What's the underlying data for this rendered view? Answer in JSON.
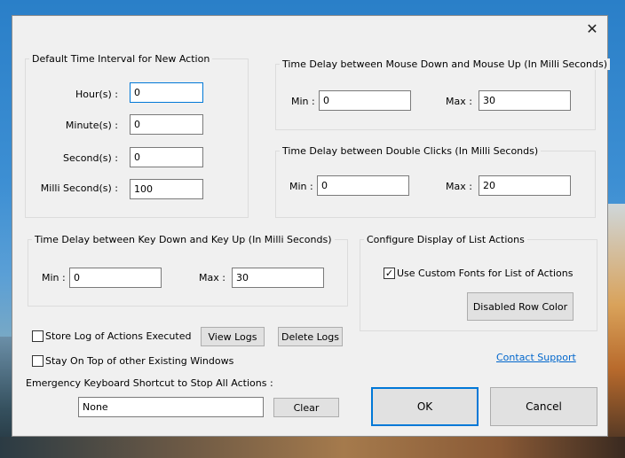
{
  "dialog": {
    "close_glyph": "✕"
  },
  "default_interval": {
    "title": "Default Time Interval for New Action",
    "hours_label": "Hour(s) :",
    "hours_value": "0",
    "minutes_label": "Minute(s) :",
    "minutes_value": "0",
    "seconds_label": "Second(s) :",
    "seconds_value": "0",
    "ms_label": "Milli Second(s) :",
    "ms_value": "100"
  },
  "mouse_delay": {
    "title": "Time Delay between Mouse Down and Mouse Up (In Milli Seconds)",
    "min_label": "Min :",
    "min_value": "0",
    "max_label": "Max :",
    "max_value": "30"
  },
  "double_click_delay": {
    "title": "Time Delay between Double Clicks (In Milli Seconds)",
    "min_label": "Min :",
    "min_value": "0",
    "max_label": "Max :",
    "max_value": "20"
  },
  "key_delay": {
    "title": "Time Delay between Key Down and Key Up (In Milli Seconds)",
    "min_label": "Min :",
    "min_value": "0",
    "max_label": "Max :",
    "max_value": "30"
  },
  "list_display": {
    "title": "Configure Display of List Actions",
    "custom_fonts_label": "Use Custom Fonts for List of Actions",
    "custom_fonts_checked": "✓",
    "disabled_row_color_label": "Disabled Row Color"
  },
  "options": {
    "store_log_label": "Store Log of Actions Executed",
    "view_logs_label": "View Logs",
    "delete_logs_label": "Delete Logs",
    "stay_on_top_label": "Stay On Top of other Existing Windows",
    "contact_support_label": "Contact Support"
  },
  "shortcut": {
    "label": "Emergency Keyboard Shortcut to Stop All Actions :",
    "value": "None",
    "clear_label": "Clear"
  },
  "footer": {
    "ok_label": "OK",
    "cancel_label": "Cancel"
  }
}
